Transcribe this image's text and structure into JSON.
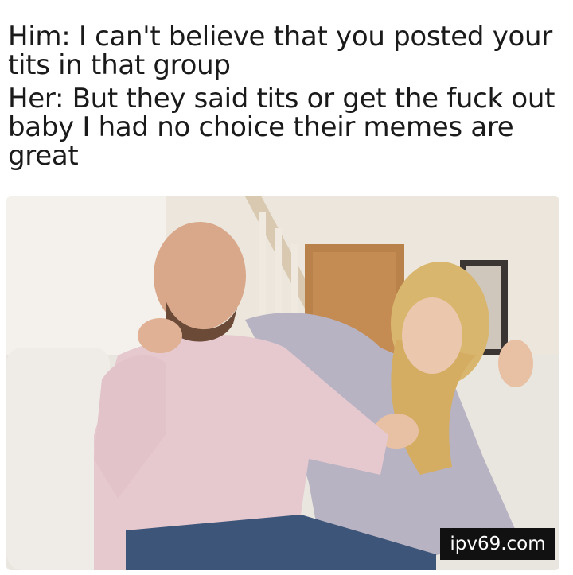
{
  "caption": {
    "line1": "Him: I can't believe that you posted your tits in that group",
    "line2": "Her: But they said tits or get the fuck out baby I had no choice their memes are great"
  },
  "watermark": {
    "text": "ipv69.com"
  },
  "photo": {
    "subject": "man-and-woman-on-couch-photo"
  }
}
